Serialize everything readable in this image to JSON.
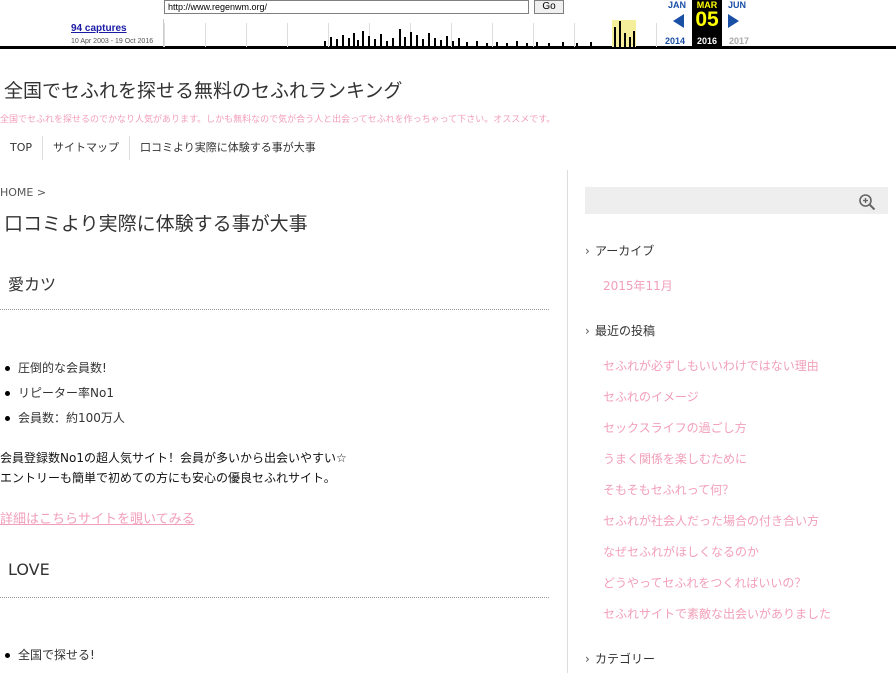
{
  "wayback": {
    "url": "http://www.regenwm.org/",
    "go_label": "Go",
    "captures": "94 captures",
    "date_range": "10 Apr 2003 - 19 Oct 2016",
    "prev_month": "JAN",
    "cur_month": "MAR",
    "next_month": "JUN",
    "cur_day": "05",
    "prev_year": "2014",
    "cur_year": "2016",
    "next_year": "2017"
  },
  "site": {
    "title": "全国でセふれを探せる無料のセふれランキング",
    "description": "全国でセふれを探せるのでかなり人気があります。しかも無料なので気が合う人と出会ってセふれを作っちゃって下さい。オススメです。",
    "nav": [
      "TOP",
      "サイトマップ",
      "口コミより実際に体験する事が大事"
    ]
  },
  "main": {
    "breadcrumb": "HOME >",
    "page_title": "口コミより実際に体験する事が大事",
    "sections": [
      {
        "title": "愛カツ",
        "features": [
          "圧倒的な会員数!",
          "リピーター率No1",
          "会員数：約100万人"
        ],
        "body": [
          "会員登録数No1の超人気サイト！会員が多いから出会いやすい☆",
          "エントリーも簡単で初めての方にも安心の優良セふれサイト。"
        ],
        "link": "詳細はこちらサイトを覗いてみる"
      },
      {
        "title": "LOVE",
        "features": [
          "全国で探せる!"
        ]
      }
    ]
  },
  "sidebar": {
    "archive_heading": "アーカイブ",
    "archive_items": [
      "2015年11月"
    ],
    "recent_heading": "最近の投稿",
    "recent_items": [
      "セふれが必ずしもいいわけではない理由",
      "セふれのイメージ",
      "セックスライフの過ごし方",
      "うまく関係を楽しむために",
      "そもそもセふれって何？",
      "セふれが社会人だった場合の付き合い方",
      "なぜセふれがほしくなるのか",
      "どうやってセふれをつくればいいの？",
      "セふれサイトで素敵な出会いがありました"
    ],
    "category_heading": "カテゴリー"
  },
  "colors": {
    "accent_pink": "#f29fb9",
    "wayback_blue": "#1a4fa6",
    "wayback_yellow": "#ffff00"
  }
}
